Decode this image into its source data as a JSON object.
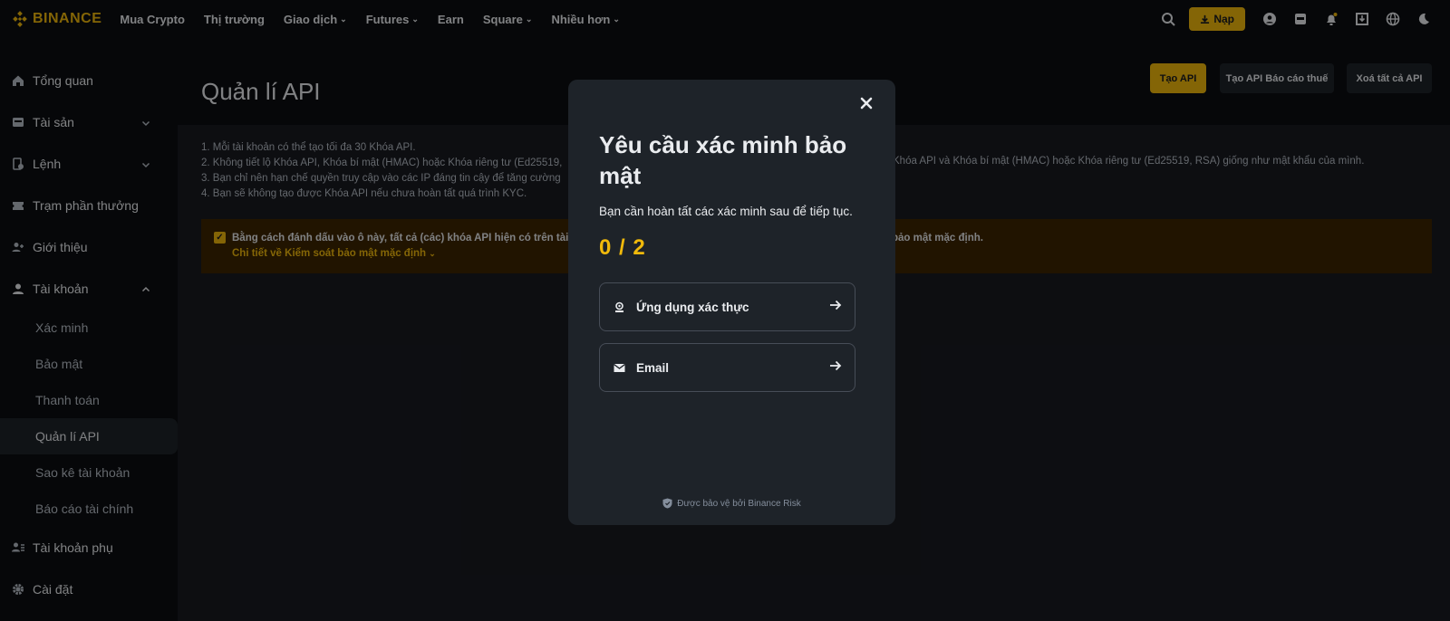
{
  "brand": {
    "name": "BINANCE"
  },
  "topnav": {
    "items": [
      {
        "label": "Mua Crypto",
        "dropdown": false
      },
      {
        "label": "Thị trường",
        "dropdown": false
      },
      {
        "label": "Giao dịch",
        "dropdown": true
      },
      {
        "label": "Futures",
        "dropdown": true
      },
      {
        "label": "Earn",
        "dropdown": false
      },
      {
        "label": "Square",
        "dropdown": true
      },
      {
        "label": "Nhiều hơn",
        "dropdown": true
      }
    ],
    "deposit_label": "Nạp",
    "icons": [
      "search-icon",
      "user-icon",
      "wallet-icon",
      "bell-icon",
      "download-app-icon",
      "globe-icon",
      "theme-icon"
    ]
  },
  "sidebar": {
    "items": [
      {
        "label": "Tổng quan",
        "icon": "home-icon"
      },
      {
        "label": "Tài sản",
        "icon": "wallet-icon",
        "expand": "down"
      },
      {
        "label": "Lệnh",
        "icon": "orders-icon",
        "expand": "down"
      },
      {
        "label": "Trạm phần thưởng",
        "icon": "ticket-icon"
      },
      {
        "label": "Giới thiệu",
        "icon": "add-user-icon"
      },
      {
        "label": "Tài khoản",
        "icon": "user-icon",
        "expand": "up"
      }
    ],
    "subitems": [
      {
        "label": "Xác minh",
        "active": false
      },
      {
        "label": "Bảo mật",
        "active": false
      },
      {
        "label": "Thanh toán",
        "active": false
      },
      {
        "label": "Quản lí API",
        "active": true
      },
      {
        "label": "Sao kê tài khoản",
        "active": false
      },
      {
        "label": "Báo cáo tài chính",
        "active": false
      }
    ],
    "bottom_items": [
      {
        "label": "Tài khoản phụ",
        "icon": "sub-account-icon"
      },
      {
        "label": "Cài đặt",
        "icon": "settings-icon"
      }
    ]
  },
  "main": {
    "title": "Quản lí API",
    "buttons": {
      "create_api": "Tạo API",
      "create_tax_api": "Tạo API Báo cáo thuế",
      "delete_all": "Xoá tất cả API"
    },
    "rules": [
      "1. Mỗi tài khoản có thể tạo tối đa 30 Khóa API.",
      "2. Không tiết lộ Khóa API, Khóa bí mật (HMAC) hoặc Khóa riêng tư (Ed25519,",
      "3. Bạn chỉ nên hạn chế quyền truy cập vào các IP đáng tin cậy để tăng cường",
      "4. Bạn sẽ không tạo được Khóa API nếu chưa hoàn tất quá trình KYC."
    ],
    "rule2_tail": "Khóa API và Khóa bí mật (HMAC) hoặc Khóa riêng tư (Ed25519, RSA) giống như mật khẩu của mình.",
    "banner": {
      "text_left": "Bằng cách đánh dấu vào ô này, tất cả (các) khóa API hiện có trên tài",
      "text_right": "bảo mật mặc định.",
      "link": "Chi tiết về Kiểm soát bảo mật mặc định"
    }
  },
  "modal": {
    "title": "Yêu cầu xác minh bảo mật",
    "subtitle": "Bạn cần hoàn tất các xác minh sau để tiếp tục.",
    "progress": "0 / 2",
    "options": [
      {
        "label": "Ứng dụng xác thực",
        "icon": "authenticator-icon"
      },
      {
        "label": "Email",
        "icon": "mail-icon"
      }
    ],
    "footer": "Được bảo vệ bởi Binance Risk"
  },
  "colors": {
    "accent": "#f0b90b",
    "bg": "#0b0e11",
    "panel": "#1e2329",
    "banner": "#3c2601"
  }
}
